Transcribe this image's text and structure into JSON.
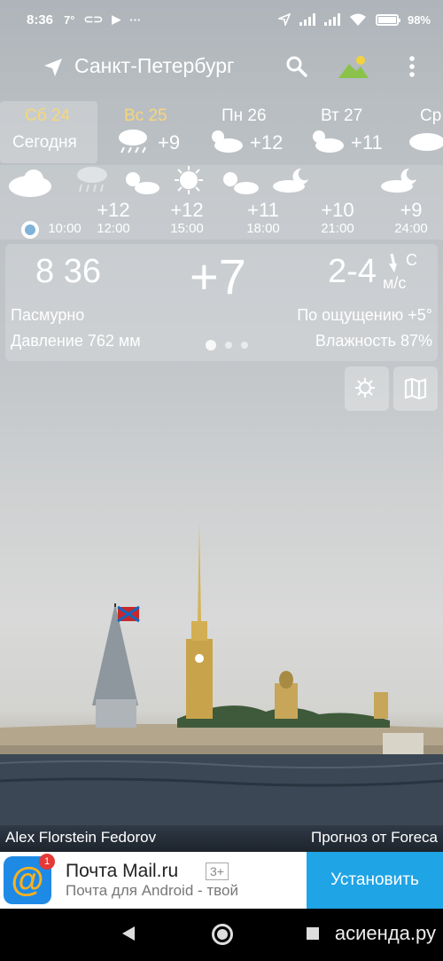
{
  "status_bar": {
    "time": "8:36",
    "temp": "7°",
    "battery": "98%",
    "battery_level": 0.98
  },
  "header": {
    "city": "Санкт-Петербург"
  },
  "days": [
    {
      "name": "Сб 24",
      "sub": "Сегодня",
      "highlight": true
    },
    {
      "name": "Вс 25",
      "temp": "+9",
      "icon": "rain-icon",
      "highlight": true
    },
    {
      "name": "Пн 26",
      "temp": "+12",
      "icon": "partly-sunny-icon",
      "highlight": false
    },
    {
      "name": "Вт 27",
      "temp": "+11",
      "icon": "partly-sunny-icon",
      "highlight": false
    },
    {
      "name": "Ср",
      "icon": "cloud-icon",
      "highlight": false
    }
  ],
  "hourly": [
    {
      "time": "10:00",
      "temp": "",
      "icon": "cloud-icon"
    },
    {
      "time": "12:00",
      "temp": "+12",
      "icon": "rain-icon"
    },
    {
      "time": "15:00",
      "temp": "+12",
      "icon": "sun-icon"
    },
    {
      "time": "18:00",
      "temp": "+11",
      "icon": "partly-sunny-icon"
    },
    {
      "time": "21:00",
      "temp": "+10",
      "icon": "night-cloud-icon"
    },
    {
      "time": "24:00",
      "temp": "+9",
      "icon": "night-cloud-icon"
    }
  ],
  "current": {
    "time": "8 36",
    "temp": "+7",
    "wind": "2-4",
    "wind_dir": "С",
    "wind_unit": "м/с",
    "condition": "Пасмурно",
    "feels_like": "По ощущению +5°",
    "pressure": "Давление 762 мм",
    "humidity": "Влажность 87%"
  },
  "credits": {
    "photo": "Alex Florstein Fedorov",
    "forecast": "Прогноз от Foreca"
  },
  "ad": {
    "title": "Почта Mail.ru",
    "age": "3+",
    "subtitle": "Почта для Android - твой",
    "badge": "1",
    "icon_char": "@",
    "button": "Установить"
  },
  "watermark": "асиенда.ру",
  "colors": {
    "highlight_day": "#f5d77a",
    "ad_button": "#1fa4e6",
    "ad_icon": "#1f8ae6"
  }
}
